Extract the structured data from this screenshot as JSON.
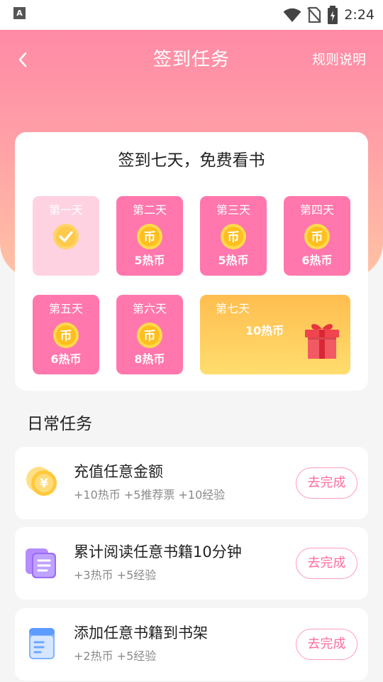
{
  "status_bar": {
    "time": "2:24",
    "notification_icon_letter": "A"
  },
  "header": {
    "back_icon": "chevron-left-icon",
    "title": "签到任务",
    "rules_label": "规则说明"
  },
  "signin": {
    "title": "签到七天，免费看书",
    "days": [
      {
        "label": "第一天",
        "reward": "",
        "state": "checked"
      },
      {
        "label": "第二天",
        "reward": "5热币",
        "coin_text": "币"
      },
      {
        "label": "第三天",
        "reward": "5热币",
        "coin_text": "币"
      },
      {
        "label": "第四天",
        "reward": "6热币",
        "coin_text": "币"
      },
      {
        "label": "第五天",
        "reward": "6热币",
        "coin_text": "币"
      },
      {
        "label": "第六天",
        "reward": "8热币",
        "coin_text": "币"
      },
      {
        "label": "第七天",
        "reward": "10热币",
        "icon": "gift-icon"
      }
    ]
  },
  "daily": {
    "title": "日常任务",
    "tasks": [
      {
        "icon": "yen-coin-icon",
        "title": "充值任意金额",
        "reward": "+10热币 +5推荐票 +10经验",
        "button": "去完成"
      },
      {
        "icon": "documents-icon",
        "title": "累计阅读任意书籍10分钟",
        "reward": "+3热币 +5经验",
        "button": "去完成"
      },
      {
        "icon": "book-icon",
        "title": "添加任意书籍到书架",
        "reward": "+2热币 +5经验",
        "button": "去完成"
      }
    ]
  },
  "colors": {
    "accent": "#ff77ac",
    "button_text": "#ff6e9f",
    "gold": "#ffc93c"
  }
}
